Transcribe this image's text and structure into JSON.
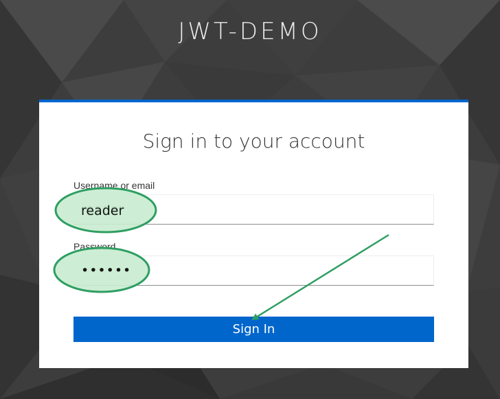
{
  "brand": {
    "title": "JWT-DEMO"
  },
  "login": {
    "heading": "Sign in to your account",
    "username_label": "Username or email",
    "username_value": "reader",
    "password_label": "Password",
    "password_value": "reader",
    "submit_label": "Sign In"
  },
  "colors": {
    "accent": "#0066cc",
    "annotation": "#2e9e62",
    "annotation_fill": "#c8eccf"
  }
}
